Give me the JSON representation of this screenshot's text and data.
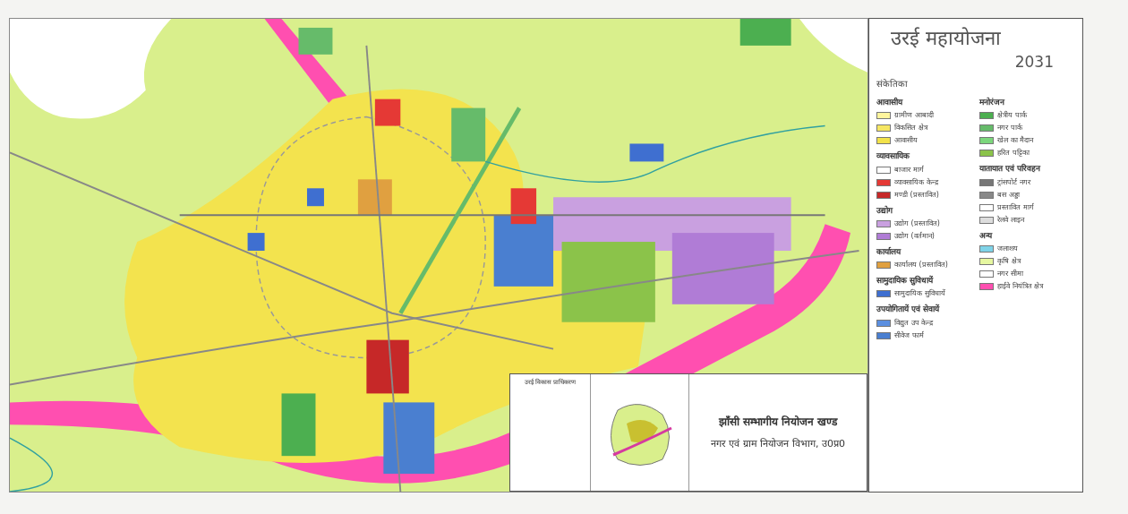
{
  "title": "उरई महायोजना",
  "year": "2031",
  "legend_heading": "संकेतिका",
  "legend_columns": [
    [
      {
        "heading": "आवासीय",
        "items": [
          {
            "label": "ग्रामीण आबादी",
            "color": "#fff59d"
          },
          {
            "label": "विकसित क्षेत्र",
            "color": "#f5e663"
          },
          {
            "label": "आवासीय",
            "color": "#f2e24a"
          }
        ]
      },
      {
        "heading": "व्यावसायिक",
        "items": [
          {
            "label": "बाजार मार्ग",
            "color": "#ffffff"
          },
          {
            "label": "व्यावसायिक केन्द्र",
            "color": "#e53935"
          },
          {
            "label": "मण्डी (प्रस्तावित)",
            "color": "#c62828"
          }
        ]
      },
      {
        "heading": "उद्योग",
        "items": [
          {
            "label": "उद्योग (प्रस्तावित)",
            "color": "#c9a0e0"
          },
          {
            "label": "उद्योग (वर्तमान)",
            "color": "#b07cd6"
          }
        ]
      },
      {
        "heading": "कार्यालय",
        "items": [
          {
            "label": "कार्यालय (प्रस्तावित)",
            "color": "#e0a040"
          }
        ]
      },
      {
        "heading": "सामुदायिक सुविधायें",
        "items": [
          {
            "label": "सामुदायिक सुविधायें",
            "color": "#3f6fd0"
          }
        ]
      },
      {
        "heading": "उपयोगितायें एवं सेवायें",
        "items": [
          {
            "label": "विद्युत उप केन्द्र",
            "color": "#5b8fe0"
          },
          {
            "label": "सीवेज फार्म",
            "color": "#4a7fd0"
          }
        ]
      }
    ],
    [
      {
        "heading": "मनोरंजन",
        "items": [
          {
            "label": "क्षेत्रीय पार्क",
            "color": "#4caf50"
          },
          {
            "label": "नगर पार्क",
            "color": "#66bb6a"
          },
          {
            "label": "खेल का मैदान",
            "color": "#7cd67c"
          },
          {
            "label": "हरित पट्टिका",
            "color": "#8bc34a"
          }
        ]
      },
      {
        "heading": "यातायात एवं परिवहन",
        "items": [
          {
            "label": "ट्रांसपोर्ट नगर",
            "color": "#777777"
          },
          {
            "label": "बस अड्डा",
            "color": "#888888"
          },
          {
            "label": "प्रस्तावित मार्ग",
            "color": "#ffffff"
          },
          {
            "label": "रेलवे लाइन",
            "color": "#dddddd"
          }
        ]
      },
      {
        "heading": "अन्य",
        "items": [
          {
            "label": "जलाशय",
            "color": "#7fd3e8"
          },
          {
            "label": "कृषि क्षेत्र",
            "color": "#e6f7a0"
          },
          {
            "label": "नगर सीमा",
            "color": "#ffffff"
          },
          {
            "label": "हाईवे नियंत्रित क्षेत्र",
            "color": "#ff4fb0"
          }
        ]
      }
    ]
  ],
  "authority_table": {
    "heading": "उरई विकास प्राधिकरण"
  },
  "office": {
    "line_1": "झाँसी सम्भागीय नियोजन खण्ड",
    "line_2": "नगर एवं ग्राम नियोजन विभाग, उ0प्र0"
  }
}
